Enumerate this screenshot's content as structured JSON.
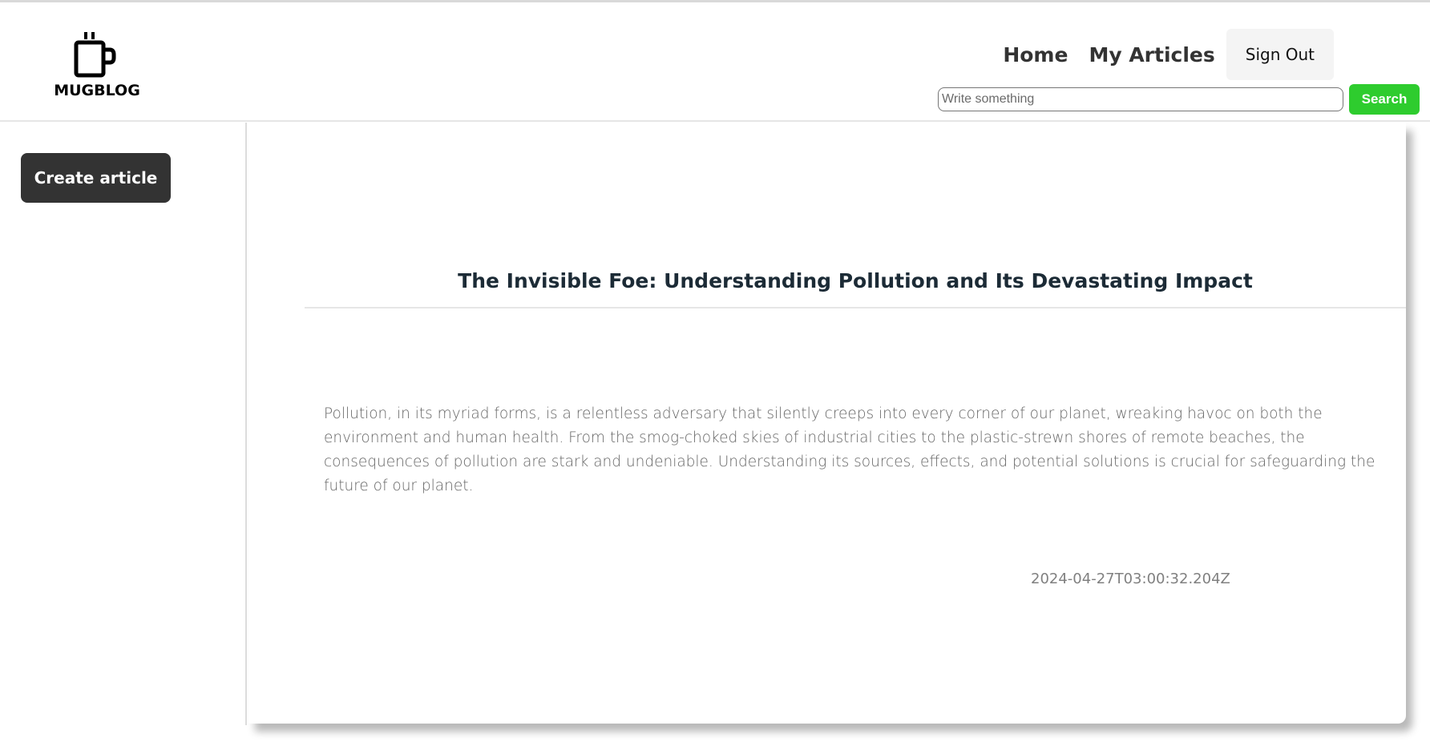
{
  "header": {
    "logo_text": "MUGBLOG",
    "nav": {
      "home": "Home",
      "my_articles": "My Articles",
      "sign_out": "Sign Out"
    },
    "search": {
      "placeholder": "Write something",
      "value": "",
      "button_label": "Search",
      "button_color": "#2ecc2e"
    }
  },
  "sidebar": {
    "create_label": "Create article"
  },
  "article": {
    "title": "The Invisible Foe: Understanding Pollution and Its Devastating Impact",
    "body": "Pollution, in its myriad forms, is a relentless adversary that silently creeps into every corner of our planet, wreaking havoc on both the environment and human health. From the smog-choked skies of industrial cities to the plastic-strewn shores of remote beaches, the consequences of pollution are stark and undeniable. Understanding its sources, effects, and potential solutions is crucial for safeguarding the future of our planet.",
    "date": "2024-04-27T03:00:32.204Z"
  },
  "icons": {
    "logo": "mug-icon"
  }
}
